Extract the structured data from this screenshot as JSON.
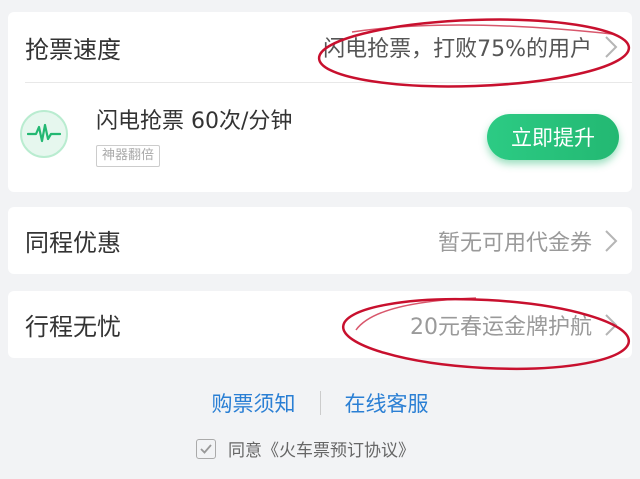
{
  "speed_card": {
    "title": "抢票速度",
    "summary": "闪电抢票，打败75%的用户",
    "plan_text": "闪电抢票 60次/分钟",
    "badge": "神器翻倍",
    "upgrade_button": "立即提升"
  },
  "promo_row": {
    "title": "同程优惠",
    "value": "暂无可用代金券"
  },
  "trip_row": {
    "title": "行程无忧",
    "value": "20元春运金牌护航"
  },
  "footer": {
    "link_notice": "购票须知",
    "link_service": "在线客服",
    "agreement": "同意《火车票预订协议》",
    "agreement_checked": true
  },
  "colors": {
    "accent_green": "#23b872",
    "link_blue": "#2a7fd4",
    "annotation_red": "#c8102e"
  },
  "icons": {
    "speed": "pulse-wave-icon",
    "row_arrow": "chevron-right-icon",
    "agree_check": "checkmark-icon"
  }
}
